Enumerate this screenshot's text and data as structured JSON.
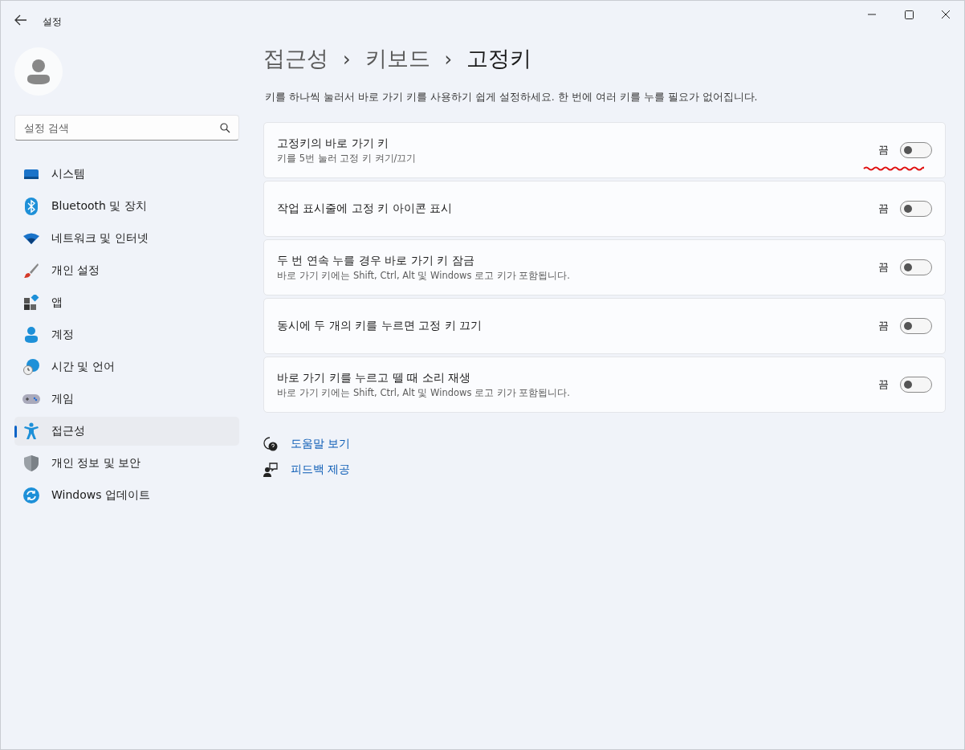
{
  "window": {
    "title": "설정"
  },
  "search": {
    "placeholder": "설정 검색"
  },
  "nav": [
    {
      "kind": "system",
      "label": "시스템",
      "selected": false
    },
    {
      "kind": "bluetooth",
      "label": "Bluetooth 및 장치",
      "selected": false
    },
    {
      "kind": "network",
      "label": "네트워크 및 인터넷",
      "selected": false
    },
    {
      "kind": "personalize",
      "label": "개인 설정",
      "selected": false
    },
    {
      "kind": "apps",
      "label": "앱",
      "selected": false
    },
    {
      "kind": "accounts",
      "label": "계정",
      "selected": false
    },
    {
      "kind": "time",
      "label": "시간 및 언어",
      "selected": false
    },
    {
      "kind": "gaming",
      "label": "게임",
      "selected": false
    },
    {
      "kind": "accessibility",
      "label": "접근성",
      "selected": true
    },
    {
      "kind": "privacy",
      "label": "개인 정보 및 보안",
      "selected": false
    },
    {
      "kind": "update",
      "label": "Windows 업데이트",
      "selected": false
    }
  ],
  "breadcrumb": [
    {
      "kind": "link",
      "text": "접근성"
    },
    {
      "kind": "separator",
      "text": "›"
    },
    {
      "kind": "link",
      "text": "키보드"
    },
    {
      "kind": "separator",
      "text": "›"
    },
    {
      "kind": "current",
      "text": "고정키"
    }
  ],
  "description": "키를 하나씩 눌러서 바로 가기 키를 사용하기 쉽게 설정하세요. 한 번에 여러 키를 누를 필요가 없어집니다.",
  "settings": [
    {
      "title": "고정키의 바로 가기 키",
      "subtitle": "키를 5번 눌러 고정 키 켜기/끄기",
      "state_label": "끔",
      "on": false
    },
    {
      "title": "작업 표시줄에 고정 키 아이콘 표시",
      "state_label": "끔",
      "on": false
    },
    {
      "title": "두 번 연속 누를 경우 바로 가기 키 잠금",
      "subtitle": "바로 가기 키에는 Shift, Ctrl, Alt 및 Windows 로고 키가 포함됩니다.",
      "state_label": "끔",
      "on": false
    },
    {
      "title": "동시에 두 개의 키를 누르면 고정 키 끄기",
      "state_label": "끔",
      "on": false
    },
    {
      "title": "바로 가기 키를 누르고 뗄 때 소리 재생",
      "subtitle": "바로 가기 키에는 Shift, Ctrl, Alt 및 Windows 로고 키가 포함됩니다.",
      "state_label": "끔",
      "on": false
    }
  ],
  "links": [
    {
      "kind": "help",
      "label": "도움말 보기"
    },
    {
      "kind": "feedback",
      "label": "피드백 제공"
    }
  ]
}
